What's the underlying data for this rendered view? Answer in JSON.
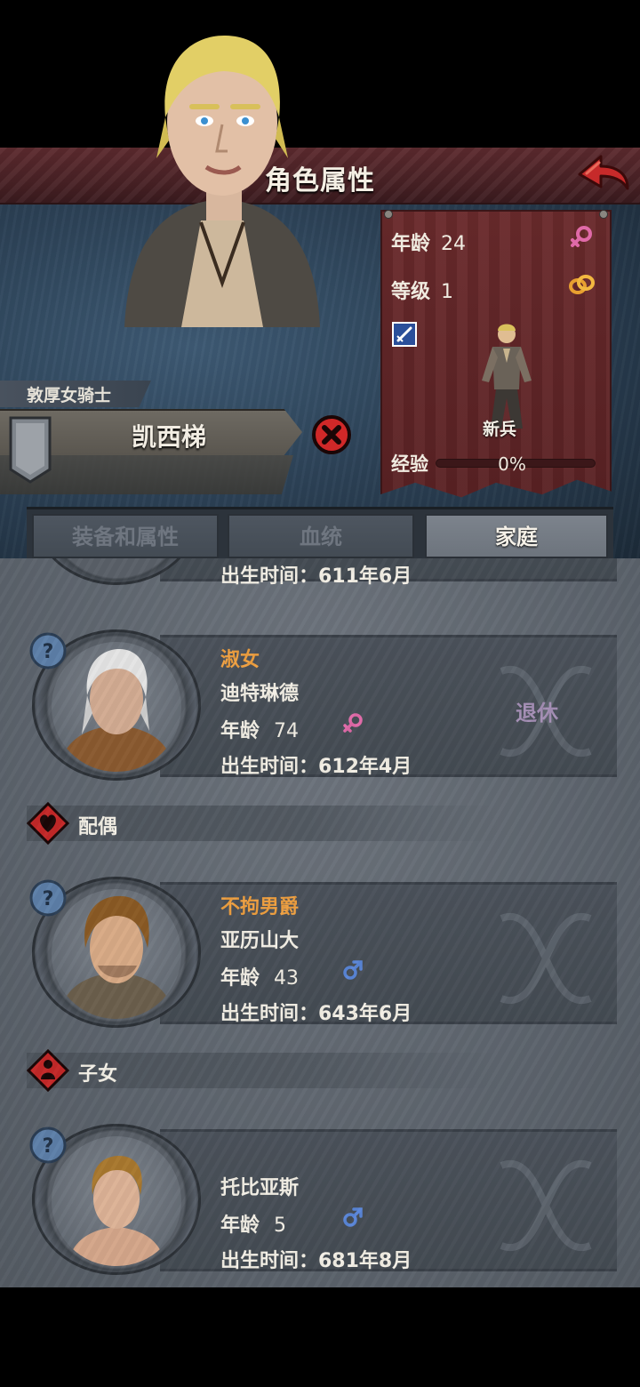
{
  "header": {
    "title": "角色属性",
    "back_icon": "red-back-arrow-icon"
  },
  "character": {
    "rank_title": "敦厚女骑士",
    "name": "凯西梯",
    "stats": {
      "age_label": "年龄",
      "age": "24",
      "level_label": "等级",
      "level": "1",
      "class_name": "新兵",
      "exp_label": "经验",
      "exp_percent": "0%",
      "exp_fraction": 0
    }
  },
  "tabs": [
    {
      "label": "装备和属性",
      "active": false
    },
    {
      "label": "血统",
      "active": false
    },
    {
      "label": "家庭",
      "active": true
    }
  ],
  "family": {
    "partial_birth": "出生时间：611年6月",
    "mother": {
      "title": "淑女",
      "name": "迪特琳德",
      "age_label": "年龄",
      "age": "74",
      "gender": "female",
      "birth": "出生时间：612年4月",
      "status": "退休"
    },
    "spouse_section": "配偶",
    "spouse": {
      "title": "不拘男爵",
      "name": "亚历山大",
      "age_label": "年龄",
      "age": "43",
      "gender": "male",
      "birth": "出生时间：643年6月"
    },
    "children_section": "子女",
    "child": {
      "name": "托比亚斯",
      "age_label": "年龄",
      "age": "5",
      "gender": "male",
      "birth": "出生时间：681年8月"
    }
  },
  "colors": {
    "title_accent": "#f0a040",
    "female": "#e06aa8",
    "male": "#5a86d8",
    "status_retired": "#a58fb6"
  }
}
